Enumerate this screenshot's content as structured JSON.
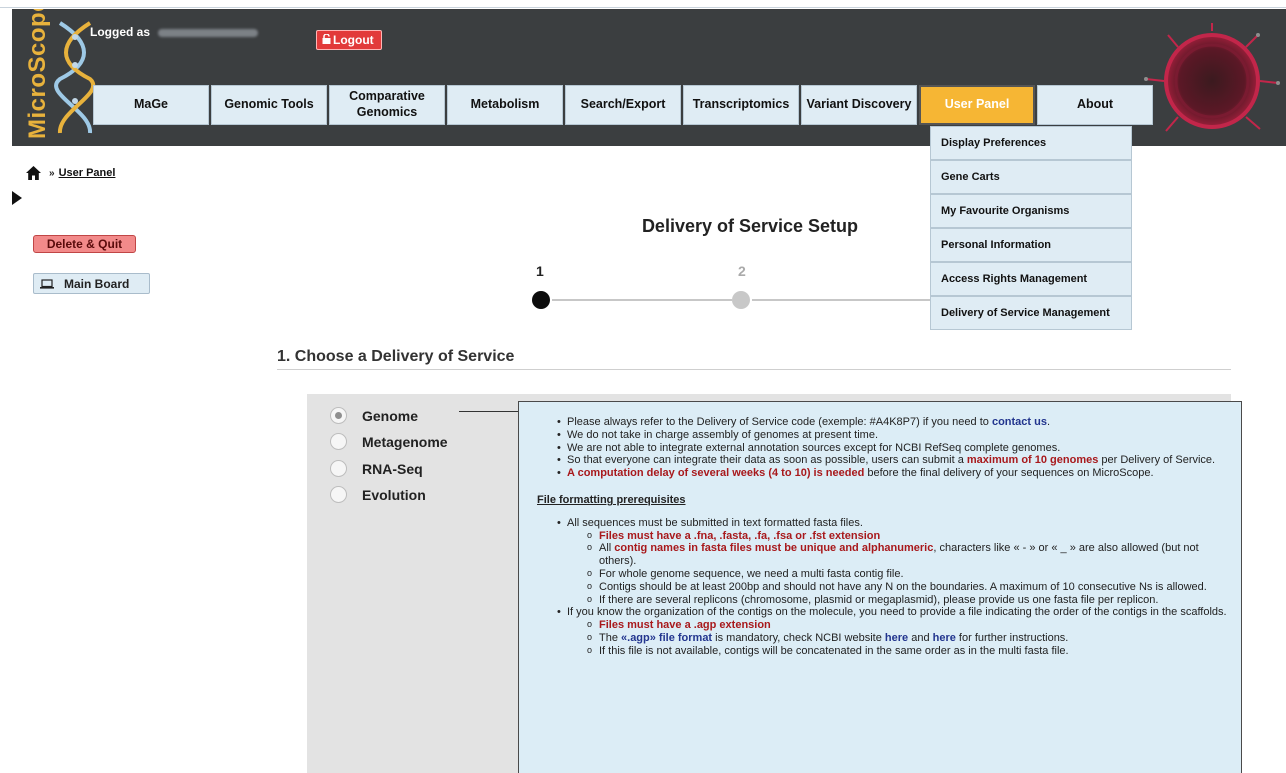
{
  "header": {
    "logo_text": "MicroScope",
    "logged_as_label": "Logged as",
    "logout_label": "Logout"
  },
  "nav": {
    "tabs": [
      {
        "label": "MaGe"
      },
      {
        "label": "Genomic Tools"
      },
      {
        "label": "Comparative Genomics"
      },
      {
        "label": "Metabolism"
      },
      {
        "label": "Search/Export"
      },
      {
        "label": "Transcriptomics"
      },
      {
        "label": "Variant Discovery"
      },
      {
        "label": "User Panel"
      },
      {
        "label": "About"
      }
    ],
    "active_tab": "User Panel",
    "dropdown_items": [
      {
        "label": "Display Preferences"
      },
      {
        "label": "Gene Carts"
      },
      {
        "label": "My Favourite Organisms"
      },
      {
        "label": "Personal Information"
      },
      {
        "label": "Access Rights Management"
      },
      {
        "label": "Delivery of Service Management"
      }
    ]
  },
  "breadcrumb": {
    "separator": "»",
    "current": "User Panel"
  },
  "sidebar": {
    "delete_quit_label": "Delete & Quit",
    "main_board_label": "Main Board"
  },
  "page": {
    "title": "Delivery of Service Setup"
  },
  "stepper": {
    "steps": [
      {
        "number": "1",
        "state": "active"
      },
      {
        "number": "2",
        "state": "inactive"
      }
    ]
  },
  "section": {
    "title": "1. Choose a Delivery of Service"
  },
  "choices": [
    {
      "label": "Genome",
      "checked": true
    },
    {
      "label": "Metagenome",
      "checked": false
    },
    {
      "label": "RNA-Seq",
      "checked": false
    },
    {
      "label": "Evolution",
      "checked": false
    }
  ],
  "info": {
    "b1_text": "Please always refer to the Delivery of Service code (exemple: #A4K8P7) if you need to ",
    "b1_link": "contact us",
    "b1_end": ".",
    "b2_text": "We do not take in charge assembly of genomes at present time.",
    "b3_text": "We are not able to integrate external annotation sources except for NCBI RefSeq complete genomes.",
    "b4_text": "So that everyone can integrate their data as soon as possible, users can submit a ",
    "b4_red": "maximum of 10 genomes",
    "b4_end": " per Delivery of Service.",
    "b5_red": "A computation delay of several weeks (4 to 10) is needed",
    "b5_end": " before the final delivery of your sequences on MicroScope.",
    "prereq_title": "File formatting prerequisites",
    "f1_text": "All sequences must be submitted in text formatted fasta files.",
    "f1a_red": "Files must have a .fna, .fasta, .fa, .fsa or .fst extension",
    "f1b_start": "All ",
    "f1b_red": "contig names in fasta files must be unique and alphanumeric",
    "f1b_end": ", characters like « - » or « _ » are also allowed (but not others).",
    "f1c_text": "For whole genome sequence, we need a multi fasta contig file.",
    "f1d_text": "Contigs should be at least 200bp and should not have any N on the boundaries. A maximum of 10 consecutive Ns is allowed.",
    "f1e_text": "If there are several replicons (chromosome, plasmid or megaplasmid), please provide us one fasta file per replicon.",
    "f2_text": "If you know the organization of the contigs on the molecule, you need to provide a file indicating the order of the contigs in the scaffolds.",
    "f2a_red": "Files must have a .agp extension",
    "f2b_start": "The ",
    "f2b_link": "«.agp» file format",
    "f2b_mid": " is mandatory, check NCBI website ",
    "f2b_here1": "here",
    "f2b_and": " and ",
    "f2b_here2": "here",
    "f2b_end": " for further instructions.",
    "f2c_text": "If this file is not available, contigs will be concatenated in the same order as in the multi fasta file."
  },
  "colors": {
    "header_bg": "#3b3e40",
    "tab_bg": "#dfecf4",
    "active_tab": "#f6b634",
    "info_bg": "#dcedf6",
    "warning_red": "#a8191c",
    "link_blue": "#22358e",
    "delete_button": "#f28a8a",
    "logout_button": "#e23a3a"
  },
  "icons": {
    "home": "home-icon",
    "lock": "lock-icon",
    "laptop": "laptop-icon",
    "toggle": "triangle-right-icon"
  }
}
